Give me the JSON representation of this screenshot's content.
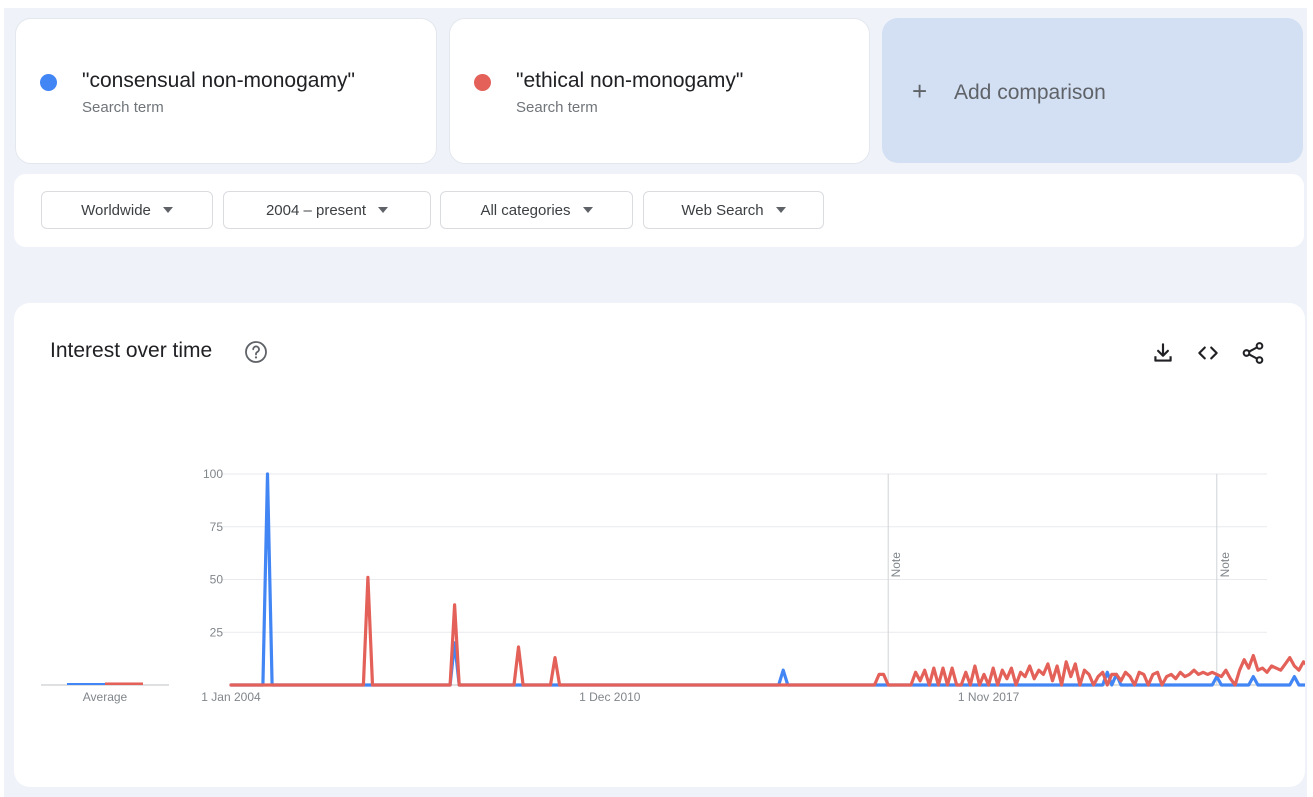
{
  "terms": [
    {
      "name": "\"consensual non-monogamy\"",
      "subtitle": "Search term",
      "color": "#4285f4"
    },
    {
      "name": "\"ethical non-monogamy\"",
      "subtitle": "Search term",
      "color": "#e36159"
    }
  ],
  "add_comparison": {
    "icon": "plus-icon",
    "label": "Add comparison"
  },
  "filters": [
    {
      "label": "Worldwide"
    },
    {
      "label": "2004 – present"
    },
    {
      "label": "All categories"
    },
    {
      "label": "Web Search"
    }
  ],
  "chart_card": {
    "title": "Interest over time",
    "help_icon": "help-circle-icon",
    "actions": [
      "download-icon",
      "embed-code-icon",
      "share-icon"
    ]
  },
  "chart_data": {
    "type": "line",
    "title": "Interest over time",
    "xlabel": "",
    "ylabel": "",
    "x_start": "2004-01",
    "x_end": "2022-12",
    "x_ticks": [
      {
        "label": "1 Jan 2004",
        "date": "2004-01"
      },
      {
        "label": "1 Dec 2010",
        "date": "2010-12"
      },
      {
        "label": "1 Nov 2017",
        "date": "2017-11"
      }
    ],
    "y_ticks": [
      25,
      50,
      75,
      100
    ],
    "ylim": [
      0,
      100
    ],
    "grid": true,
    "notes": [
      {
        "date": "2016-01",
        "label": "Note"
      },
      {
        "date": "2022-01",
        "label": "Note"
      }
    ],
    "average": {
      "label": "Average",
      "values": [
        0.4,
        1.2
      ]
    },
    "series": [
      {
        "name": "\"consensual non-monogamy\"",
        "color": "#4285f4",
        "points": [
          [
            "2004-01",
            0
          ],
          [
            "2004-08",
            0
          ],
          [
            "2004-09",
            100
          ],
          [
            "2004-10",
            0
          ],
          [
            "2008-01",
            0
          ],
          [
            "2008-02",
            20
          ],
          [
            "2008-03",
            0
          ],
          [
            "2014-01",
            0
          ],
          [
            "2014-02",
            7
          ],
          [
            "2014-03",
            0
          ],
          [
            "2017-11",
            0
          ],
          [
            "2019-12",
            0
          ],
          [
            "2020-01",
            6
          ],
          [
            "2020-02",
            0
          ],
          [
            "2020-03",
            5
          ],
          [
            "2020-04",
            0
          ],
          [
            "2021-12",
            0
          ],
          [
            "2022-01",
            4
          ],
          [
            "2022-02",
            0
          ],
          [
            "2022-08",
            0
          ],
          [
            "2022-09",
            4
          ],
          [
            "2022-10",
            0
          ],
          [
            "2023-05",
            0
          ],
          [
            "2023-06",
            4
          ],
          [
            "2023-07",
            0
          ],
          [
            "2023-09",
            0
          ],
          [
            "2023-10",
            4
          ],
          [
            "2023-11",
            0
          ],
          [
            "2024-01",
            0
          ]
        ]
      },
      {
        "name": "\"ethical non-monogamy\"",
        "color": "#e36159",
        "points": [
          [
            "2004-01",
            0
          ],
          [
            "2006-06",
            0
          ],
          [
            "2006-07",
            51
          ],
          [
            "2006-08",
            0
          ],
          [
            "2008-01",
            0
          ],
          [
            "2008-02",
            38
          ],
          [
            "2008-03",
            0
          ],
          [
            "2009-03",
            0
          ],
          [
            "2009-04",
            18
          ],
          [
            "2009-05",
            0
          ],
          [
            "2009-11",
            0
          ],
          [
            "2009-12",
            13
          ],
          [
            "2010-01",
            0
          ],
          [
            "2015-10",
            0
          ],
          [
            "2015-11",
            5
          ],
          [
            "2015-12",
            5
          ],
          [
            "2016-01",
            0
          ],
          [
            "2016-06",
            0
          ],
          [
            "2016-07",
            6
          ],
          [
            "2016-08",
            2
          ],
          [
            "2016-09",
            7
          ],
          [
            "2016-10",
            0
          ],
          [
            "2016-11",
            8
          ],
          [
            "2016-12",
            0
          ],
          [
            "2017-01",
            8
          ],
          [
            "2017-02",
            0
          ],
          [
            "2017-03",
            8
          ],
          [
            "2017-04",
            0
          ],
          [
            "2017-05",
            0
          ],
          [
            "2017-06",
            6
          ],
          [
            "2017-07",
            0
          ],
          [
            "2017-08",
            9
          ],
          [
            "2017-09",
            0
          ],
          [
            "2017-10",
            5
          ],
          [
            "2017-11",
            0
          ],
          [
            "2017-12",
            8
          ],
          [
            "2018-01",
            0
          ],
          [
            "2018-02",
            7
          ],
          [
            "2018-03",
            3
          ],
          [
            "2018-04",
            8
          ],
          [
            "2018-05",
            0
          ],
          [
            "2018-06",
            6
          ],
          [
            "2018-07",
            4
          ],
          [
            "2018-08",
            9
          ],
          [
            "2018-09",
            3
          ],
          [
            "2018-10",
            7
          ],
          [
            "2018-11",
            5
          ],
          [
            "2018-12",
            10
          ],
          [
            "2019-01",
            2
          ],
          [
            "2019-02",
            9
          ],
          [
            "2019-03",
            0
          ],
          [
            "2019-04",
            11
          ],
          [
            "2019-05",
            4
          ],
          [
            "2019-06",
            10
          ],
          [
            "2019-07",
            0
          ],
          [
            "2019-08",
            7
          ],
          [
            "2019-09",
            5
          ],
          [
            "2019-10",
            0
          ],
          [
            "2019-11",
            4
          ],
          [
            "2019-12",
            6
          ],
          [
            "2020-01",
            0
          ],
          [
            "2020-02",
            5
          ],
          [
            "2020-03",
            5
          ],
          [
            "2020-04",
            2
          ],
          [
            "2020-05",
            6
          ],
          [
            "2020-06",
            4
          ],
          [
            "2020-07",
            0
          ],
          [
            "2020-08",
            6
          ],
          [
            "2020-09",
            5
          ],
          [
            "2020-10",
            0
          ],
          [
            "2020-11",
            5
          ],
          [
            "2020-12",
            6
          ],
          [
            "2021-01",
            0
          ],
          [
            "2021-02",
            4
          ],
          [
            "2021-03",
            5
          ],
          [
            "2021-04",
            3
          ],
          [
            "2021-05",
            6
          ],
          [
            "2021-06",
            4
          ],
          [
            "2021-07",
            5
          ],
          [
            "2021-08",
            7
          ],
          [
            "2021-09",
            5
          ],
          [
            "2021-10",
            6
          ],
          [
            "2021-11",
            5
          ],
          [
            "2021-12",
            6
          ],
          [
            "2022-01",
            5
          ],
          [
            "2022-02",
            4
          ],
          [
            "2022-03",
            7
          ],
          [
            "2022-04",
            3
          ],
          [
            "2022-05",
            0
          ],
          [
            "2022-06",
            7
          ],
          [
            "2022-07",
            12
          ],
          [
            "2022-08",
            8
          ],
          [
            "2022-09",
            14
          ],
          [
            "2022-10",
            7
          ],
          [
            "2022-11",
            8
          ],
          [
            "2022-12",
            6
          ],
          [
            "2023-01",
            9
          ],
          [
            "2023-02",
            8
          ],
          [
            "2023-03",
            7
          ],
          [
            "2023-04",
            10
          ],
          [
            "2023-05",
            13
          ],
          [
            "2023-06",
            9
          ],
          [
            "2023-07",
            7
          ],
          [
            "2023-08",
            11
          ],
          [
            "2023-09",
            9
          ],
          [
            "2023-10",
            12
          ],
          [
            "2023-11",
            8
          ],
          [
            "2023-12",
            14
          ],
          [
            "2024-01",
            1
          ]
        ]
      }
    ]
  }
}
